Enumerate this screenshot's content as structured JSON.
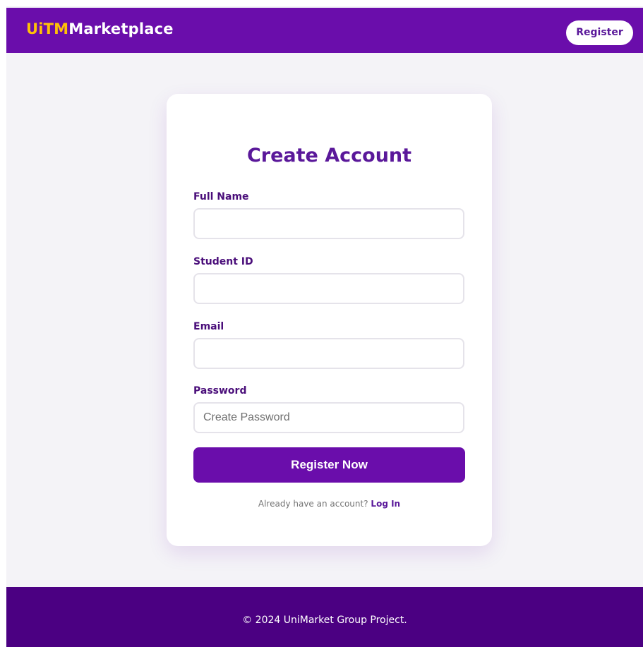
{
  "header": {
    "logo_accent": "UiTM",
    "logo_main": "Marketplace",
    "register_label": "Register"
  },
  "form": {
    "title": "Create Account",
    "full_name_label": "Full Name",
    "full_name_value": "",
    "student_id_label": "Student ID",
    "student_id_value": "",
    "email_label": "Email",
    "email_value": "",
    "password_label": "Password",
    "password_placeholder": "Create Password",
    "password_value": "",
    "submit_label": "Register Now",
    "login_prompt": "Already have an account?",
    "login_link": "Log In"
  },
  "footer": {
    "text": "© 2024 UniMarket Group Project."
  },
  "colors": {
    "primary": "#6a0dab",
    "accent": "#ffc107",
    "footer": "#4b0082",
    "background": "#f4f3f7"
  }
}
